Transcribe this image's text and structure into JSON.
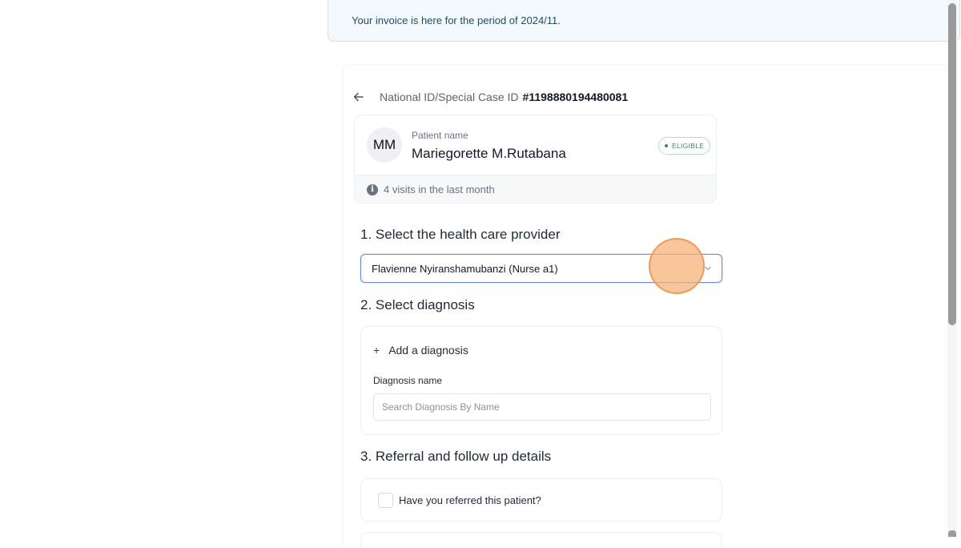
{
  "banner": {
    "text": "Your invoice is here for the period of 2024/11."
  },
  "patient_header": {
    "id_label": "National ID/Special Case ID",
    "id_value": "#1198880194480081"
  },
  "patient": {
    "initials": "MM",
    "name_label": "Patient name",
    "name": "Mariegorette M.Rutabana",
    "status_badge": "ELIGIBLE",
    "visits_text": "4 visits in the last month"
  },
  "sections": {
    "provider_title": "1. Select the health care provider",
    "provider_selected": "Flavienne Nyiranshamubanzi (Nurse a1)",
    "diagnosis_title": "2. Select diagnosis",
    "add_diagnosis_label": "Add a diagnosis",
    "diagnosis_name_label": "Diagnosis name",
    "diagnosis_placeholder": "Search Diagnosis By Name",
    "referral_title": "3. Referral and follow up details",
    "referral_question": "Have you referred this patient?"
  },
  "colors": {
    "accent": "#6a8ed6",
    "badge_green": "#3a8a5a",
    "banner_bg": "#f4f9fd"
  },
  "icons": {
    "back": "arrow-left-icon",
    "info": "info-icon",
    "chevron": "chevron-down-icon",
    "plus": "plus-icon"
  }
}
